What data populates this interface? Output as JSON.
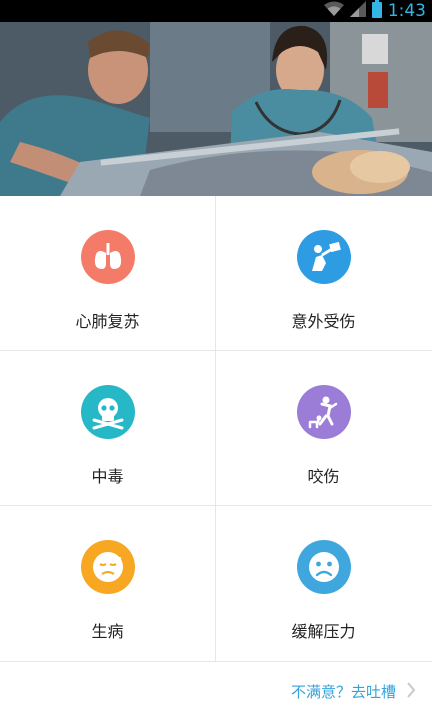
{
  "status_bar": {
    "time": "1:43"
  },
  "hero": {
    "alt": ""
  },
  "categories": [
    {
      "label": "心肺复苏",
      "icon": "lungs-icon",
      "color": "#f47b67"
    },
    {
      "label": "意外受伤",
      "icon": "accident-icon",
      "color": "#2e9ce2"
    },
    {
      "label": "中毒",
      "icon": "skull-icon",
      "color": "#26b8c6"
    },
    {
      "label": "咬伤",
      "icon": "dog-bite-icon",
      "color": "#9b7dd8"
    },
    {
      "label": "生病",
      "icon": "sick-face-icon",
      "color": "#f7a722"
    },
    {
      "label": "缓解压力",
      "icon": "sad-face-icon",
      "color": "#3fa7dd"
    }
  ],
  "footer": {
    "feedback_label": "不满意？去吐槽"
  },
  "colors": {
    "accent": "#33a3dc",
    "status_time": "#33b5e5"
  }
}
